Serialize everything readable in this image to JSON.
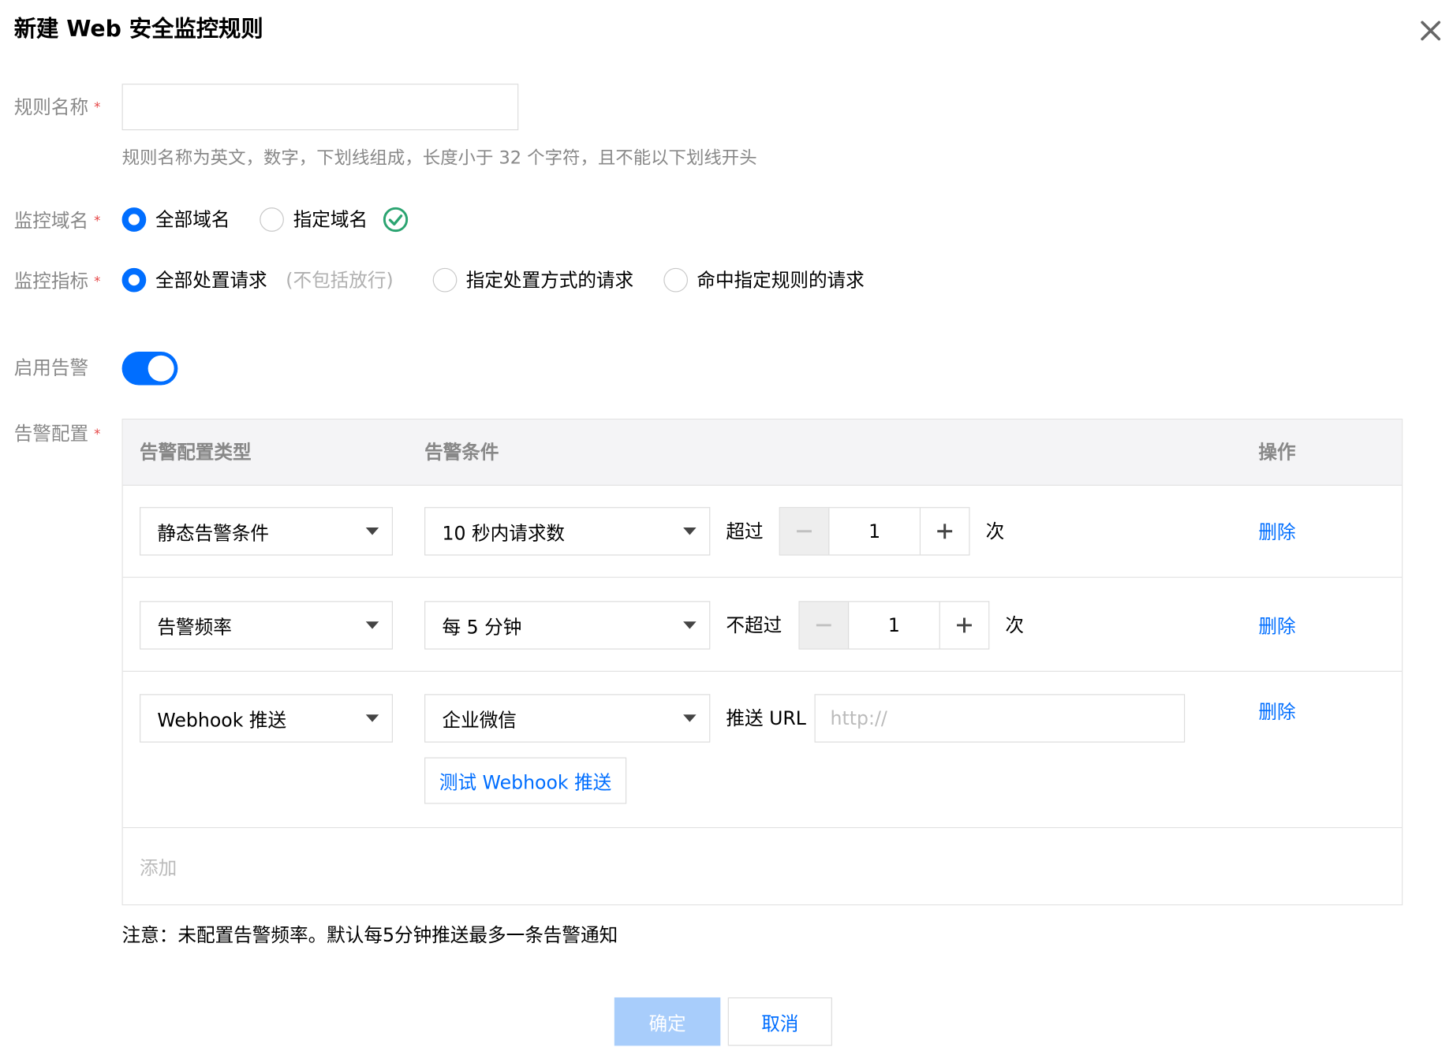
{
  "dialog": {
    "title": "新建 Web 安全监控规则",
    "close_icon": "close-icon"
  },
  "rule_name": {
    "label": "规则名称",
    "required_mark": "*",
    "value": "",
    "hint": "规则名称为英文，数字，下划线组成，长度小于 32 个字符，且不能以下划线开头"
  },
  "domain": {
    "label": "监控域名",
    "required_mark": "*",
    "options": [
      "全部域名",
      "指定域名"
    ],
    "selected": "全部域名",
    "status_icon": "check-circle-icon",
    "status_color": "#2ba471"
  },
  "metric": {
    "label": "监控指标",
    "required_mark": "*",
    "options": [
      "全部处置请求",
      "指定处置方式的请求",
      "命中指定规则的请求"
    ],
    "option1_note": "(不包括放行)",
    "selected": "全部处置请求"
  },
  "alert": {
    "label": "启用告警",
    "enabled": true
  },
  "alert_config": {
    "label": "告警配置",
    "required_mark": "*",
    "headers": [
      "告警配置类型",
      "告警条件",
      "操作"
    ],
    "rows": [
      {
        "type": "静态告警条件",
        "condition": "10 秒内请求数",
        "compare": "超过",
        "count": "1",
        "unit": "次",
        "action": "删除"
      },
      {
        "type": "告警频率",
        "condition": "每 5 分钟",
        "compare": "不超过",
        "count": "1",
        "unit": "次",
        "action": "删除"
      },
      {
        "type": "Webhook 推送",
        "condition": "企业微信",
        "url_label": "推送 URL",
        "url_placeholder": "http://",
        "url_value": "",
        "test_button": "测试 Webhook 推送",
        "action": "删除"
      }
    ],
    "add_label": "添加"
  },
  "note": "注意：未配置告警频率。默认每5分钟推送最多一条告警通知",
  "footer": {
    "confirm": "确定",
    "cancel": "取消"
  },
  "colors": {
    "accent": "#006eff",
    "required": "#e54545",
    "confirm_disabled": "#a8cdfb"
  }
}
